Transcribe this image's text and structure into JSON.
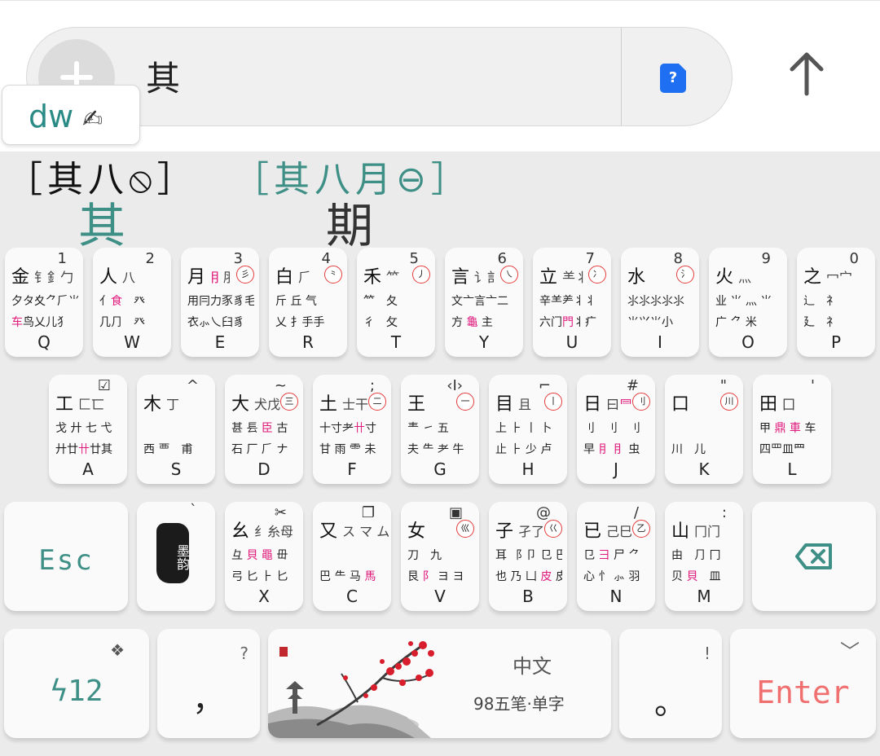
{
  "input": {
    "text": "其"
  },
  "spell_tip": {
    "code": "dw",
    "icon": "✍"
  },
  "candidates": {
    "roots_current": "［其八⦸］",
    "roots_next": "［其八月⊖］",
    "items": [
      "其",
      "期"
    ]
  },
  "keys_row1": [
    {
      "letter": "Q",
      "num": "1",
      "main": "金",
      "comp": "钅釒勹",
      "mark": "",
      "r2": "夕タ夊⺈⺁⺌",
      "r3": "⻋鸟乂儿犭"
    },
    {
      "letter": "W",
      "num": "2",
      "main": "人",
      "comp": "八",
      "mark": "",
      "r2": "亻食　癶",
      "r3": "几⺆　癶"
    },
    {
      "letter": "E",
      "num": "3",
      "main": "月",
      "comp": "⺝⺼",
      "mark": "彡",
      "r2": "用冃力豕豸毛",
      "r3": "衣⺗乀臼豸"
    },
    {
      "letter": "R",
      "num": "4",
      "main": "白",
      "comp": "⺁",
      "mark": "⺀",
      "r2": "斤 丘 气",
      "r3": "乂 扌手手"
    },
    {
      "letter": "T",
      "num": "5",
      "main": "禾",
      "comp": "⺮",
      "mark": "丿",
      "r2": "⺮　夂",
      "r3": "彳　攵"
    },
    {
      "letter": "Y",
      "num": "6",
      "main": "言",
      "comp": "讠訁丶",
      "mark": "㇏",
      "r2": "文亠言亠二",
      "r3": "方 ⿔ 主"
    },
    {
      "letter": "U",
      "num": "7",
      "main": "立",
      "comp": "⺷丬",
      "mark": "冫",
      "r2": "辛⺷⺶丬丬",
      "r3": "六门門丬疒"
    },
    {
      "letter": "I",
      "num": "8",
      "main": "水",
      "comp": "",
      "mark": "氵",
      "r2": "⺢⺢⺢⺢⺢",
      "r3": "⺌⺍⺌小"
    },
    {
      "letter": "O",
      "num": "9",
      "main": "火",
      "comp": "灬",
      "mark": "",
      "r2": "业 ⺌ 灬 ⺌",
      "r3": "广 ⺈ 米"
    },
    {
      "letter": "P",
      "num": "0",
      "main": "之",
      "comp": "冖宀",
      "mark": "",
      "r2": "辶　礻",
      "r3": "廴　礻"
    }
  ],
  "keys_row2": [
    {
      "letter": "A",
      "num": "☑",
      "main": "工",
      "comp": "匚匸",
      "mark": "",
      "r2": "戈 廾 七 弋",
      "r3": "廾廿卄廿其"
    },
    {
      "letter": "S",
      "num": "^",
      "main": "木",
      "comp": "丁",
      "mark": "",
      "r2": "",
      "r3": "西 覀　甫"
    },
    {
      "letter": "D",
      "num": "~",
      "main": "大",
      "comp": "犬戊",
      "mark": "三",
      "r2": "甚 镸 ⾂ 古",
      "r3": "石 厂 ⺁ ナ"
    },
    {
      "letter": "F",
      "num": ";",
      "main": "土",
      "comp": "士干",
      "mark": "二",
      "r2": "十寸耂卄寸",
      "r3": "甘 雨 ⻗ 未"
    },
    {
      "letter": "G",
      "num": "‹Ⅰ›",
      "main": "王",
      "comp": "",
      "mark": "一",
      "r2": "龶 ㇀ 五",
      "r3": "夫 ⺧ ⺹ 牛"
    },
    {
      "letter": "H",
      "num": "⌐",
      "main": "目",
      "comp": "且",
      "mark": "丨",
      "r2": "上 ⺊ 丨 卜",
      "r3": "止 ⺊ 少 卢"
    },
    {
      "letter": "J",
      "num": "#",
      "main": "日",
      "comp": "曰⺜",
      "mark": "刂",
      "r2": "刂　⺉　刂",
      "r3": "早 ⺝ ⺝ 虫"
    },
    {
      "letter": "K",
      "num": "\"",
      "main": "口",
      "comp": "",
      "mark": "川",
      "r2": "",
      "r3": "川　儿"
    },
    {
      "letter": "L",
      "num": "'",
      "main": "田",
      "comp": "囗",
      "mark": "",
      "r2": "甲 ⿍ 車 车",
      "r3": "四罒皿⺫"
    }
  ],
  "keys_row3": [
    {
      "letter": "X",
      "num": "✂",
      "main": "幺",
      "comp": "纟糸母",
      "mark": "",
      "r2": "彑 ⾙ 黽 毌",
      "r3": "弓 匕 ⺊ 匕"
    },
    {
      "letter": "C",
      "num": "❐",
      "main": "又",
      "comp": "ス マ ム",
      "mark": "",
      "r2": "",
      "r3": "巴 ⺧ 马 馬"
    },
    {
      "letter": "V",
      "num": "▣",
      "main": "女",
      "comp": "",
      "mark": "巛",
      "r2": "刀　九",
      "r3": "艮 ⻖ ヨ ヨ"
    },
    {
      "letter": "B",
      "num": "@",
      "main": "子",
      "comp": "孑了",
      "mark": "巜",
      "r2": "耳 ⻏ 卩 ⺋ 巴",
      "r3": "也 乃 凵 ⽪ 皮"
    },
    {
      "letter": "N",
      "num": "/",
      "main": "已",
      "comp": "己巳",
      "mark": "乙",
      "r2": "⺋ ⺕ 尸 ⺈",
      "r3": "心 ⺖ ⺗ 羽"
    },
    {
      "letter": "M",
      "num": ":",
      "main": "山",
      "comp": "冂门",
      "mark": "",
      "r2": "由　⺆ 冂",
      "r3": "贝 貝　皿"
    }
  ],
  "special_keys": {
    "esc": "Esc",
    "seal_text": "墨韵",
    "seal_corner": "`",
    "backspace_icon": "backspace",
    "numpad": "ϟ12",
    "numpad_corner": "❖",
    "comma": "，",
    "comma_corner": "?",
    "lang": "中文",
    "mode": "98五笔·单字",
    "period": "。",
    "period_corner": "!",
    "enter": "Enter",
    "enter_corner": "﹀"
  }
}
